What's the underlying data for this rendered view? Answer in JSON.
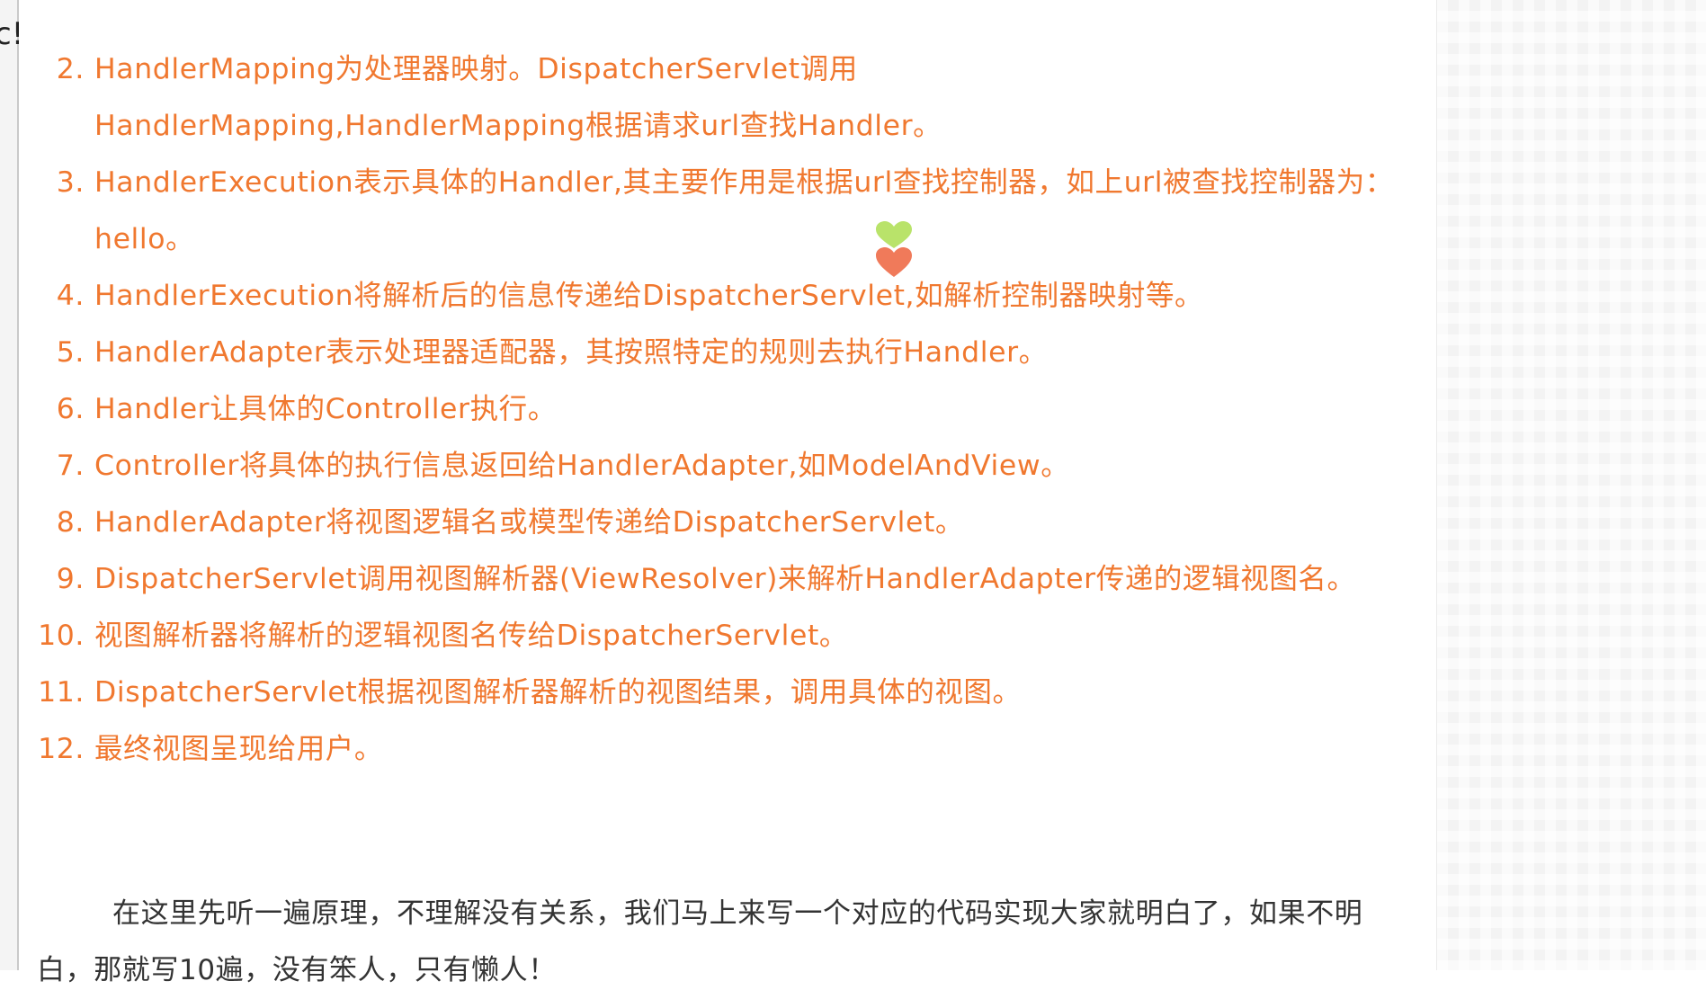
{
  "edge_fragment": "c!",
  "steps": [
    {
      "num": "2.",
      "text": "HandlerMapping为处理器映射。DispatcherServlet调用HandlerMapping,HandlerMapping根据请求url查找Handler。"
    },
    {
      "num": "3.",
      "text": "HandlerExecution表示具体的Handler,其主要作用是根据url查找控制器，如上url被查找控制器为：hello。"
    },
    {
      "num": "4.",
      "text": "HandlerExecution将解析后的信息传递给DispatcherServlet,如解析控制器映射等。"
    },
    {
      "num": "5.",
      "text": "HandlerAdapter表示处理器适配器，其按照特定的规则去执行Handler。"
    },
    {
      "num": "6.",
      "text": "Handler让具体的Controller执行。"
    },
    {
      "num": "7.",
      "text": "Controller将具体的执行信息返回给HandlerAdapter,如ModelAndView。"
    },
    {
      "num": "8.",
      "text": "HandlerAdapter将视图逻辑名或模型传递给DispatcherServlet。"
    },
    {
      "num": "9.",
      "text": "DispatcherServlet调用视图解析器(ViewResolver)来解析HandlerAdapter传递的逻辑视图名。"
    },
    {
      "num": "10.",
      "text": "视图解析器将解析的逻辑视图名传给DispatcherServlet。"
    },
    {
      "num": "11.",
      "text": "DispatcherServlet根据视图解析器解析的视图结果，调用具体的视图。"
    },
    {
      "num": "12.",
      "text": "最终视图呈现给用户。"
    }
  ],
  "paragraph": "在这里先听一遍原理，不理解没有关系，我们马上来写一个对应的代码实现大家就明白了，如果不明白，那就写10遍，没有笨人，只有懒人！",
  "colors": {
    "step_text": "#f0782f",
    "paragraph_text": "#333333",
    "heart_top": "#b9e36a",
    "heart_bottom": "#f07a5a"
  },
  "icons": {
    "cursor_marker": "heart-icon"
  }
}
